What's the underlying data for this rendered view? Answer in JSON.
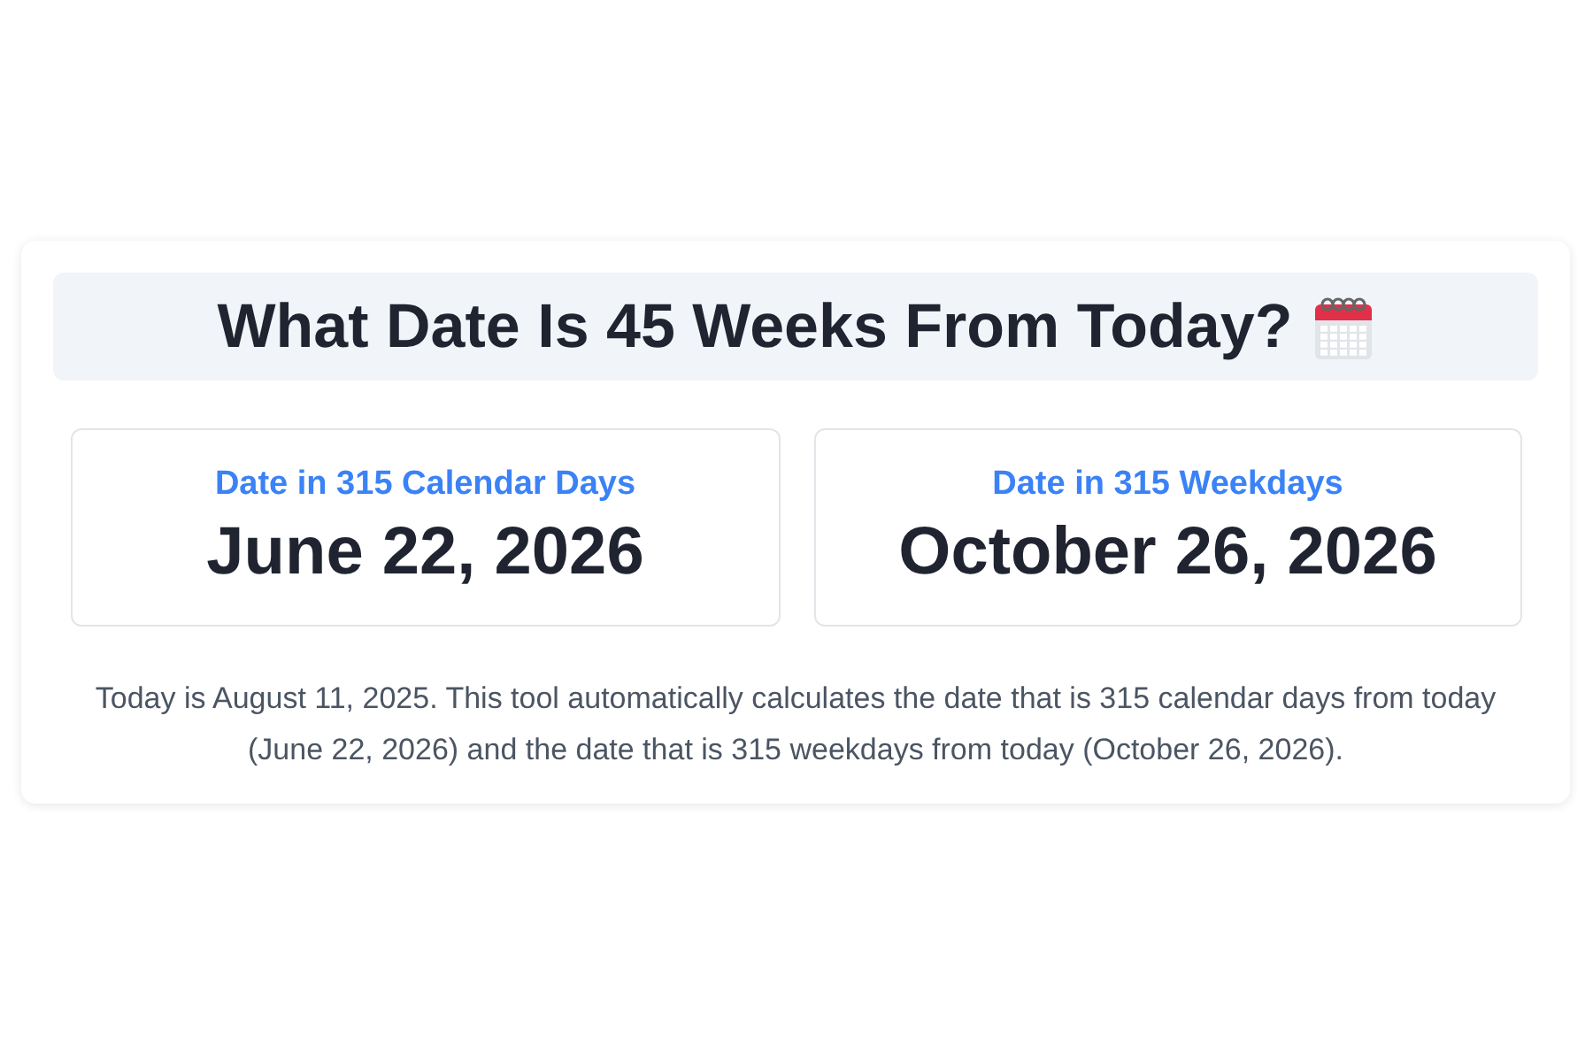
{
  "title": "What Date Is 45 Weeks From Today?",
  "results": [
    {
      "label": "Date in 315 Calendar Days",
      "date": "June 22, 2026"
    },
    {
      "label": "Date in 315 Weekdays",
      "date": "October 26, 2026"
    }
  ],
  "description": "Today is August 11, 2025. This tool automatically calculates the date that is 315 calendar days from today (June 22, 2026) and the date that is 315 weekdays from today (October 26, 2026)."
}
